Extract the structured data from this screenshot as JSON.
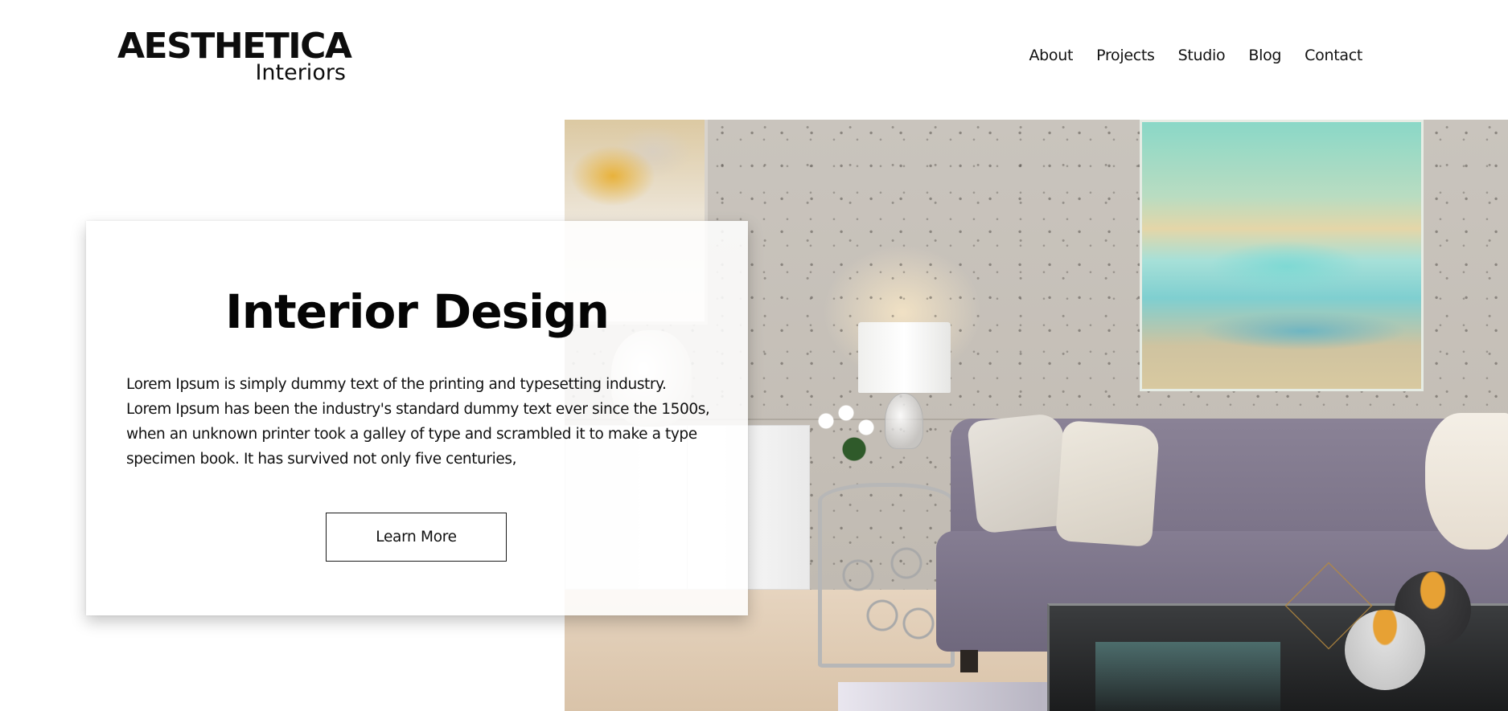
{
  "brand": {
    "name": "AESTHETICA",
    "tagline": "Interiors"
  },
  "nav": {
    "items": [
      "About",
      "Projects",
      "Studio",
      "Blog",
      "Contact"
    ]
  },
  "hero": {
    "title": "Interior Design",
    "body": "Lorem Ipsum is simply dummy text of the printing and typesetting industry. Lorem Ipsum has been the industry's standard dummy text ever since the 1500s, when an unknown printer took a galley of type and scrambled it to make a type specimen book. It has survived not only five centuries,",
    "cta_label": "Learn More"
  },
  "colors": {
    "background": "#ffffff",
    "text": "#111111",
    "card_background": "#ffffff",
    "button_border": "#1a1a1a"
  }
}
